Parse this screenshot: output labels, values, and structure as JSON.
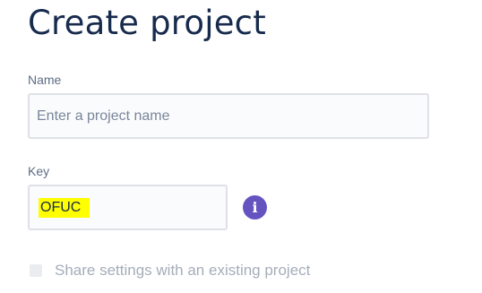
{
  "page": {
    "title": "Create project"
  },
  "form": {
    "name": {
      "label": "Name",
      "value": "",
      "placeholder": "Enter a project name"
    },
    "key": {
      "label": "Key",
      "value": "OFUC",
      "info_icon": "info-icon"
    },
    "share_settings": {
      "label": "Share settings with an existing project",
      "checked": false,
      "disabled": true
    }
  },
  "colors": {
    "title": "#172b4d",
    "label": "#5e6c84",
    "info_icon_bg": "#6554c0",
    "highlight": "#ffff00",
    "disabled_text": "#a5adba"
  }
}
